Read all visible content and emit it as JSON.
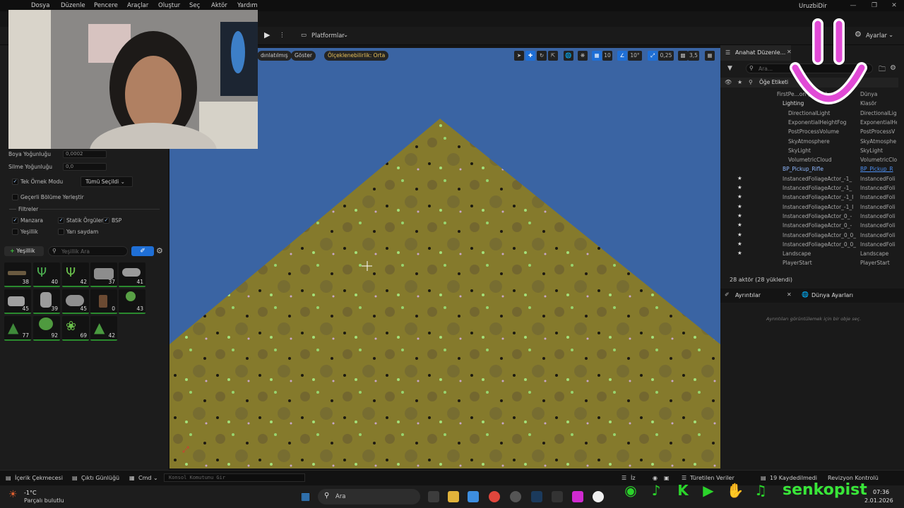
{
  "menu": {
    "items": [
      "Dosya",
      "Düzenle",
      "Pencere",
      "Araçlar",
      "Oluştur",
      "Seç",
      "Aktör",
      "Yardım"
    ],
    "project_name": "UruzbiDir"
  },
  "toolbar": {
    "platforms_label": "Platformlar",
    "settings_label": "Ayarlar"
  },
  "foliage": {
    "paint_density_label": "Boya Yoğunluğu",
    "paint_density_value": "0,0002",
    "erase_density_label": "Silme Yoğunluğu",
    "erase_density_value": "0,0",
    "single_instance_label": "Tek Örnek Modu",
    "selection_dropdown": "Tümü Seçildi",
    "place_current_level_label": "Geçerli Bölüme Yerleştir",
    "filters_header": "Filtreler",
    "filters": {
      "landscape": "Manzara",
      "static_meshes": "Statik Örgüler",
      "bsp": "BSP",
      "foliage": "Yeşillik",
      "translucent": "Yarı saydam"
    },
    "add_button": "Yeşillik",
    "search_placeholder": "Yeşillik Ara",
    "tiles": [
      "38",
      "40",
      "42",
      "37",
      "41",
      "45",
      "39",
      "45",
      "0",
      "43",
      "77",
      "92",
      "69",
      "42"
    ]
  },
  "viewport": {
    "lit_label": "dınlatılmış",
    "show_label": "Göster",
    "scalability_label": "Ölçeklenebilirlik: Orta",
    "grid_value": "10",
    "angle_value": "10°",
    "scale_value": "0,25",
    "camera_speed": "3,5"
  },
  "outliner": {
    "tab_title": "Anahat Düzenle...",
    "search_placeholder": "Ara...",
    "column_label": "Öğe Etiketi",
    "rows": [
      {
        "name": "FirstPe...on (Editör)",
        "type": "Dünya"
      },
      {
        "name": "Lighting",
        "type": "Klasör"
      },
      {
        "name": "DirectionalLight",
        "type": "DirectionalLig"
      },
      {
        "name": "ExponentialHeightFog",
        "type": "ExponentialHe"
      },
      {
        "name": "PostProcessVolume",
        "type": "PostProcessV"
      },
      {
        "name": "SkyAtmosphere",
        "type": "SkyAtmosphe"
      },
      {
        "name": "SkyLight",
        "type": "SkyLight"
      },
      {
        "name": "VolumetricCloud",
        "type": "VolumetricClo"
      },
      {
        "name": "BP_Pickup_Rifle",
        "type": "BP_Pickup_R"
      },
      {
        "name": "InstancedFoliageActor_-1_",
        "type": "InstancedFoli"
      },
      {
        "name": "InstancedFoliageActor_-1_",
        "type": "InstancedFoli"
      },
      {
        "name": "InstancedFoliageActor_-1_I",
        "type": "InstancedFoli"
      },
      {
        "name": "InstancedFoliageActor_-1_I",
        "type": "InstancedFoli"
      },
      {
        "name": "InstancedFoliageActor_0_-",
        "type": "InstancedFoli"
      },
      {
        "name": "InstancedFoliageActor_0_-",
        "type": "InstancedFoli"
      },
      {
        "name": "InstancedFoliageActor_0_0_",
        "type": "InstancedFoli"
      },
      {
        "name": "InstancedFoliageActor_0_0_",
        "type": "InstancedFoli"
      },
      {
        "name": "Landscape",
        "type": "Landscape"
      },
      {
        "name": "PlayerStart",
        "type": "PlayerStart"
      }
    ],
    "actor_count": "28 aktör (28 yüklendi)"
  },
  "details": {
    "tab_details": "Ayrıntılar",
    "tab_world": "Dünya Ayarları",
    "empty_text": "Ayrıntıları görüntülemek için bir obje seç."
  },
  "bottom": {
    "content_drawer": "İçerik Çekmecesi",
    "output_log": "Çıktı Günlüğü",
    "cmd": "Cmd",
    "console_placeholder": "Konsol Komutunu Gir",
    "derived_data": "Türetilen Veriler",
    "saved": "19 Kaydedilmedi",
    "revision": "Revizyon Kontrolü",
    "iz": "İz"
  },
  "taskbar": {
    "weather_temp": "-1°C",
    "weather_desc": "Parçalı bulutlu",
    "search_label": "Ara",
    "time": "07:36",
    "date": "2.01.2026"
  },
  "overlay": {
    "brand": "senkopist"
  },
  "colors": {
    "accent_blue": "#1f6fd6",
    "scalability_yellow": "#e8c15a",
    "sky": "#3a64a3",
    "terrain": "#857a2c",
    "social_green": "#2bd42b",
    "smiley_pink": "#e14ad6"
  }
}
